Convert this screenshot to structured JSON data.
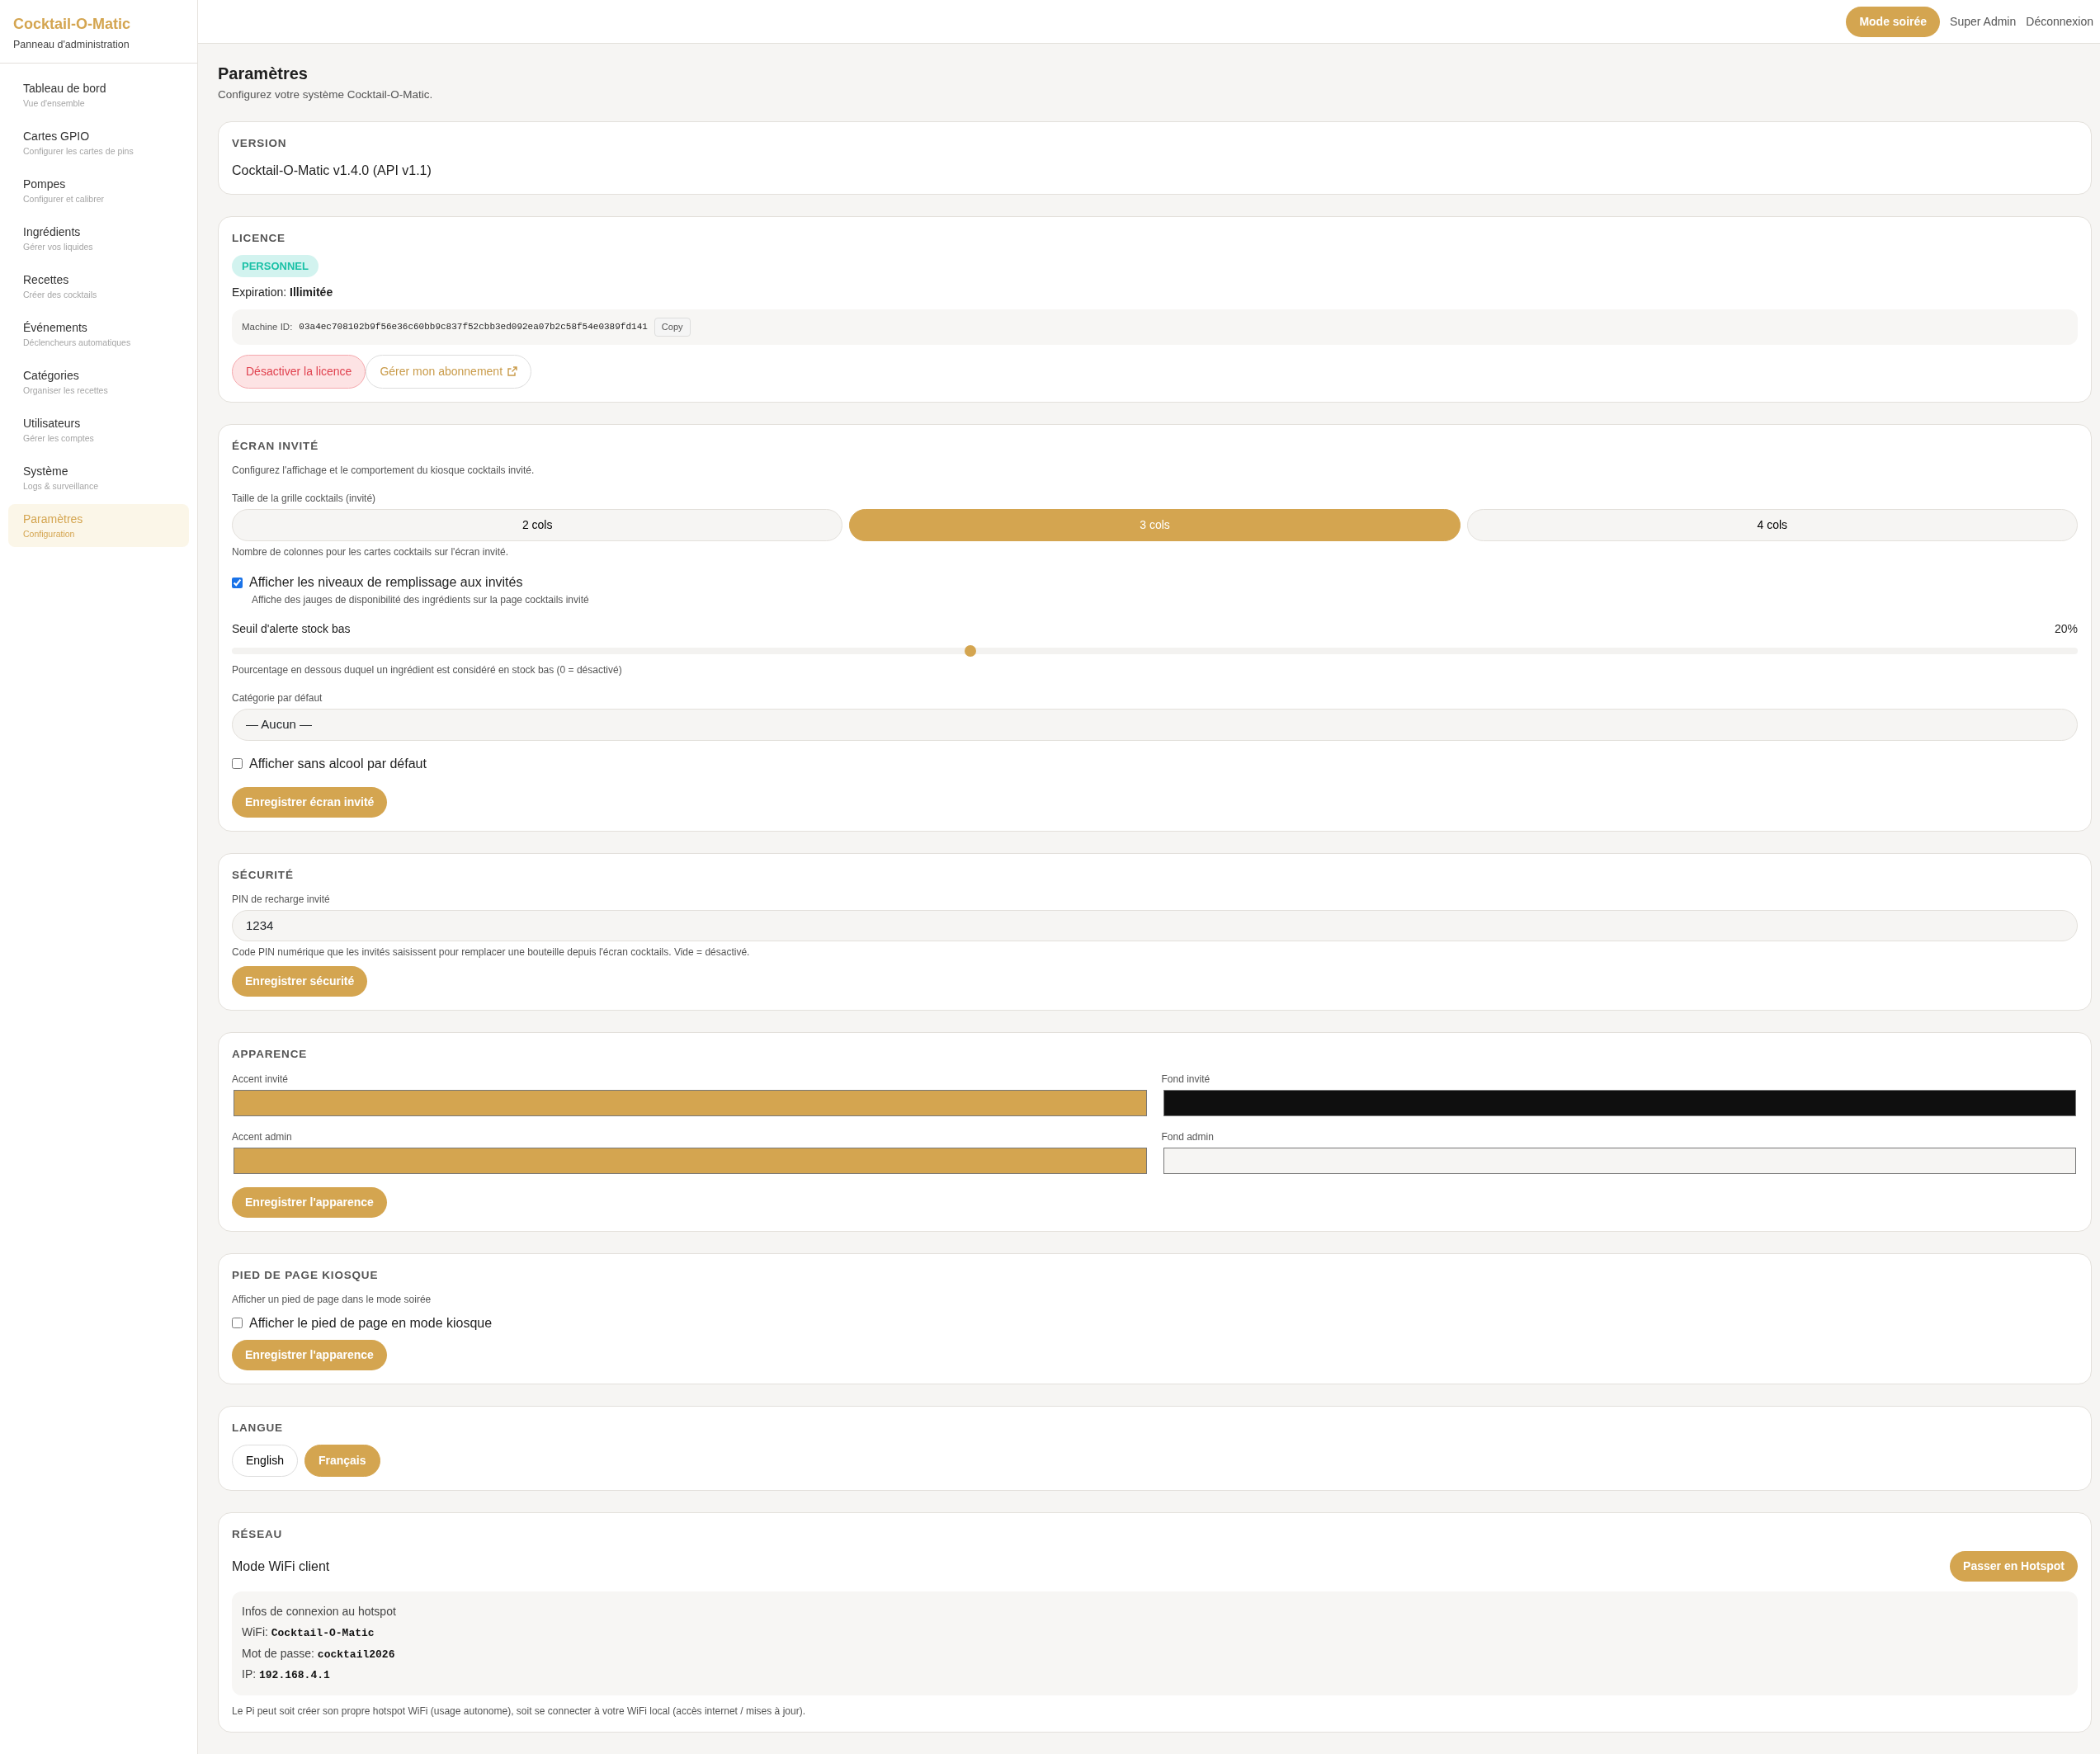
{
  "app": {
    "title": "Cocktail-O-Matic",
    "subtitle": "Panneau d'administration"
  },
  "sidebar": {
    "items": [
      {
        "label": "Tableau de bord",
        "sublabel": "Vue d'ensemble",
        "selected": false
      },
      {
        "label": "Cartes GPIO",
        "sublabel": "Configurer les cartes de pins",
        "selected": false
      },
      {
        "label": "Pompes",
        "sublabel": "Configurer et calibrer",
        "selected": false
      },
      {
        "label": "Ingrédients",
        "sublabel": "Gérer vos liquides",
        "selected": false
      },
      {
        "label": "Recettes",
        "sublabel": "Créer des cocktails",
        "selected": false
      },
      {
        "label": "Événements",
        "sublabel": "Déclencheurs automatiques",
        "selected": false
      },
      {
        "label": "Catégories",
        "sublabel": "Organiser les recettes",
        "selected": false
      },
      {
        "label": "Utilisateurs",
        "sublabel": "Gérer les comptes",
        "selected": false
      },
      {
        "label": "Système",
        "sublabel": "Logs & surveillance",
        "selected": false
      },
      {
        "label": "Paramètres",
        "sublabel": "Configuration",
        "selected": true
      }
    ]
  },
  "topbar": {
    "party_mode_button": "Mode soirée",
    "user": "Super Admin",
    "logout": "Déconnexion"
  },
  "page": {
    "title": "Paramètres",
    "subtitle": "Configurez votre système Cocktail-O-Matic."
  },
  "version": {
    "heading": "VERSION",
    "value": "Cocktail-O-Matic v1.4.0 (API v1.1)"
  },
  "licence": {
    "heading": "LICENCE",
    "badge": "PERSONNEL",
    "expiration": "Expiration: **Illimitée**",
    "machine_id_label": "Machine ID:",
    "machine_id": "03a4ec708102b9f56e36c60bb9c837f52cbb3ed092ea07b2c58f54e0389fd141",
    "copy_button": "Copy",
    "deactivate_button": "Désactiver la licence",
    "manage_button": "Gérer mon abonnement"
  },
  "guest_screen": {
    "heading": "ÉCRAN INVITÉ",
    "description": "Configurez l'affichage et le comportement du kiosque cocktails invité.",
    "grid_label": "Taille de la grille cocktails (invité)",
    "grid_options": [
      {
        "label": "2 cols",
        "selected": false
      },
      {
        "label": "3 cols",
        "selected": true
      },
      {
        "label": "4 cols",
        "selected": false
      }
    ],
    "grid_hint": "Nombre de colonnes pour les cartes cocktails sur l'écran invité.",
    "fill_levels": {
      "label": "Afficher les niveaux de remplissage aux invités",
      "hint": "Affiche des jauges de disponibilité des ingrédients sur la page cocktails invité",
      "checked": true
    },
    "threshold": {
      "label": "Seuil d'alerte stock bas",
      "reading": "20%",
      "level": 0.4,
      "hint": "Pourcentage en dessous duquel un ingrédient est considéré en stock bas (0 = désactivé)"
    },
    "default_category": {
      "label": "Catégorie par défaut",
      "value": "— Aucun —"
    },
    "non_alcoholic": {
      "label": "Afficher sans alcool par défaut",
      "checked": false
    },
    "save_button": "Enregistrer écran invité"
  },
  "security": {
    "heading": "SÉCURITÉ",
    "pin_label": "PIN de recharge invité",
    "pin_value": "1234",
    "hint": "Code PIN numérique que les invités saisissent pour remplacer une bouteille depuis l'écran cocktails. Vide = désactivé.",
    "save_button": "Enregistrer sécurité"
  },
  "appearance": {
    "heading": "APPARENCE",
    "colors": [
      {
        "label": "Accent invité",
        "color": "#d4a550"
      },
      {
        "label": "Fond invité",
        "color": "#0f0f0f"
      },
      {
        "label": "Accent admin",
        "color": "#d4a550"
      },
      {
        "label": "Fond admin",
        "color": "#f6f5f3"
      }
    ],
    "save_button": "Enregistrer l'apparence"
  },
  "kiosk_footer": {
    "heading": "PIED DE PAGE KIOSQUE",
    "description": "Afficher un pied de page dans le mode soirée",
    "show_footer": {
      "label": "Afficher le pied de page en mode kiosque",
      "checked": false
    },
    "save_button": "Enregistrer l'apparence"
  },
  "language": {
    "heading": "LANGUE",
    "options": [
      {
        "label": "English",
        "selected": false
      },
      {
        "label": "Français",
        "selected": true
      }
    ]
  },
  "network": {
    "heading": "RÉSEAU",
    "mode": "Mode WiFi client",
    "switch_button": "Passer en Hotspot",
    "info": {
      "title": "Infos de connexion au hotspot",
      "lines": [
        {
          "label": "WiFi:",
          "value": "Cocktail-O-Matic"
        },
        {
          "label": "Mot de passe:",
          "value": "cocktail2026"
        },
        {
          "label": "IP:",
          "value": "192.168.4.1"
        }
      ]
    },
    "hint": "Le Pi peut soit créer son propre hotspot WiFi (usage autonome), soit se connecter à votre WiFi local (accès internet / mises à jour)."
  }
}
